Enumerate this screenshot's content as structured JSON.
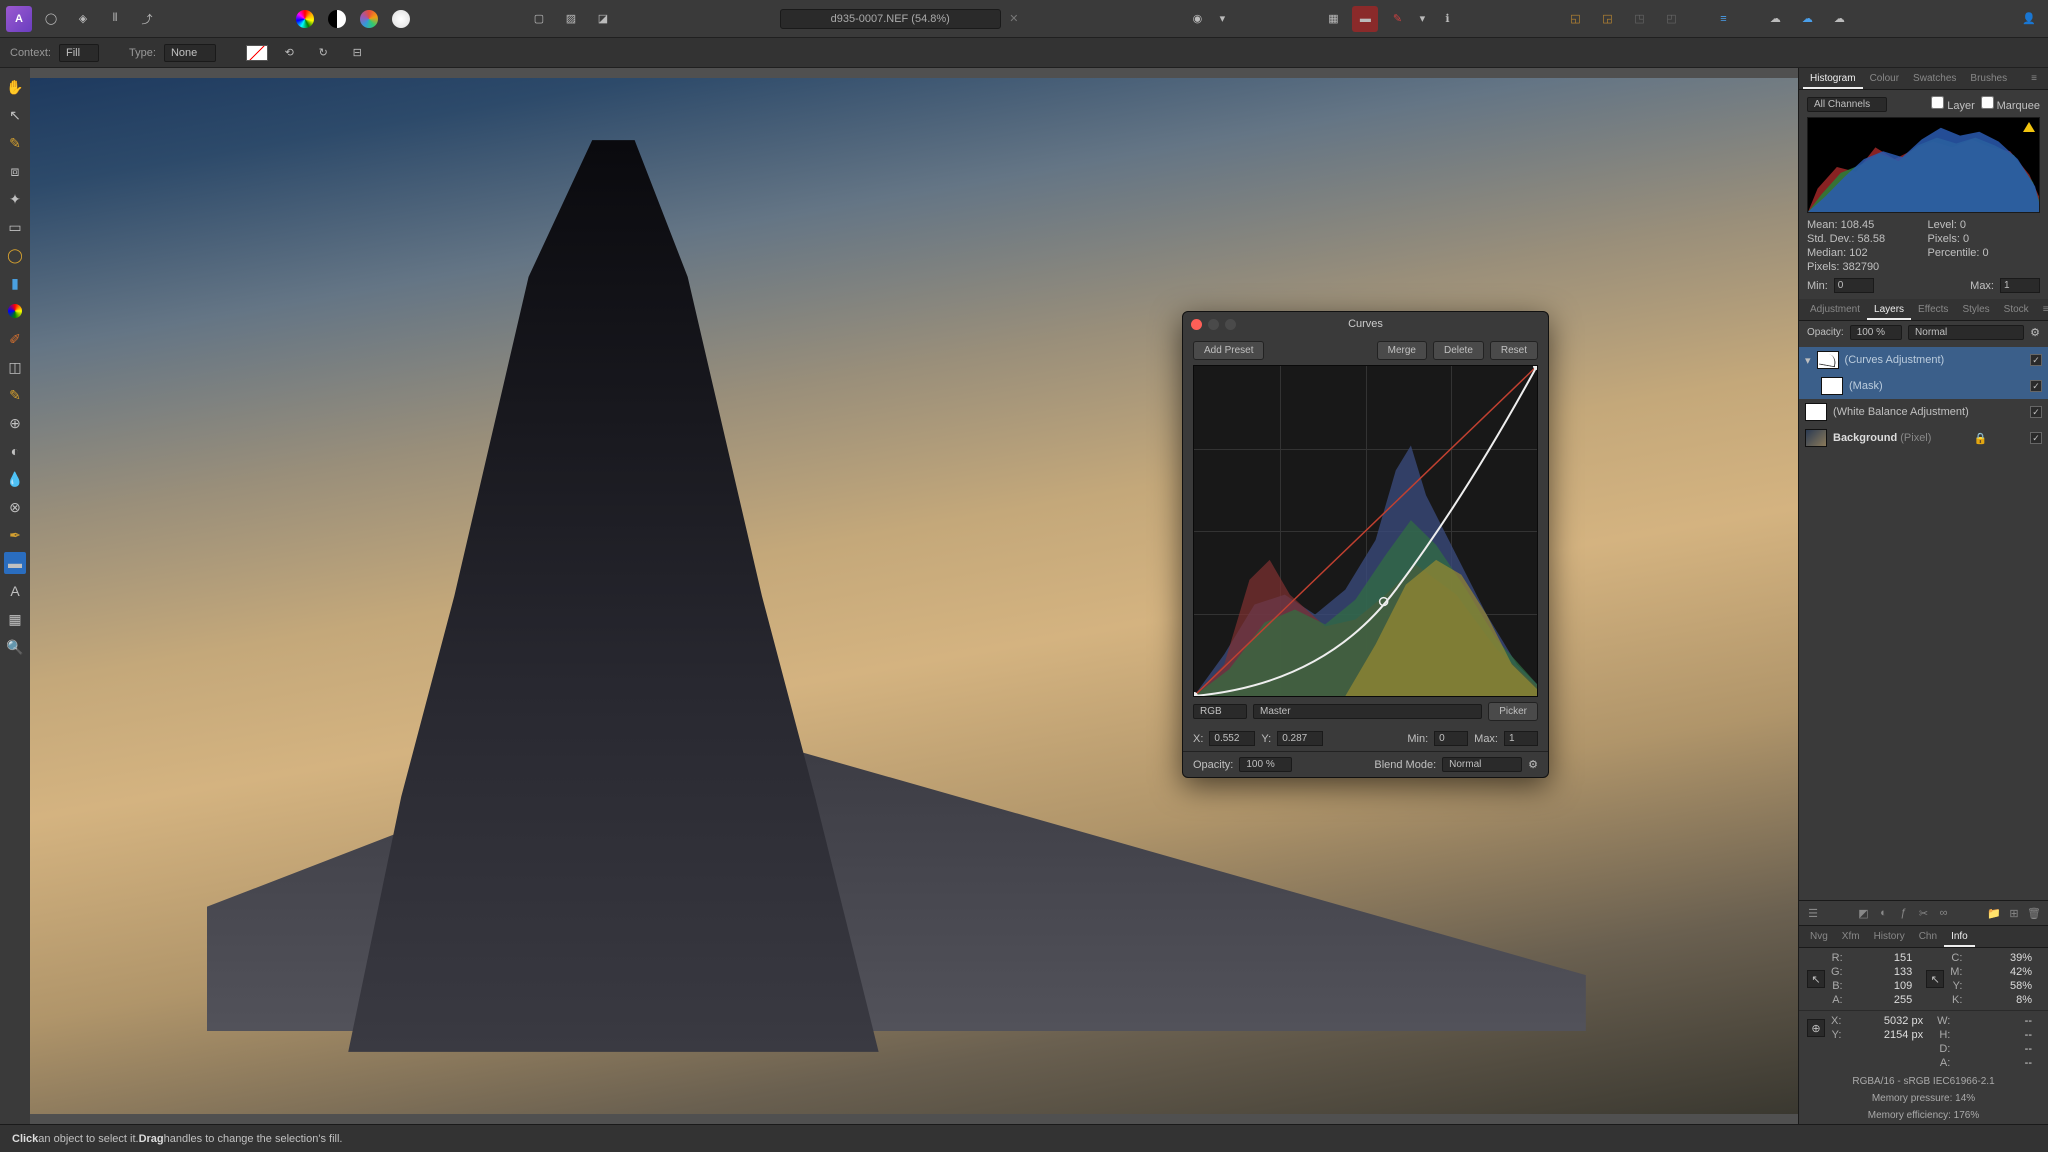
{
  "app": {
    "doc_title": "d935-0007.NEF (54.8%)"
  },
  "context": {
    "label1": "Context:",
    "val1": "Fill",
    "label2": "Type:",
    "val2": "None"
  },
  "status": {
    "click": "Click",
    "click_txt": " an object to select it. ",
    "drag": "Drag",
    "drag_txt": " handles to change the selection's fill."
  },
  "hist_tabs": [
    "Histogram",
    "Colour",
    "Swatches",
    "Brushes"
  ],
  "hist": {
    "channels": "All Channels",
    "layer": "Layer",
    "marquee": "Marquee",
    "mean_k": "Mean:",
    "mean_v": "108.45",
    "sd_k": "Std. Dev.:",
    "sd_v": "58.58",
    "med_k": "Median:",
    "med_v": "102",
    "px_k": "Pixels:",
    "px_v": "382790",
    "lvl_k": "Level:",
    "lvl_v": "0",
    "pxl_k": "Pixels:",
    "pxl_v": "0",
    "pct_k": "Percentile:",
    "pct_v": "0",
    "min_k": "Min:",
    "min_v": "0",
    "max_k": "Max:",
    "max_v": "1"
  },
  "ltabs": [
    "Adjustment",
    "Layers",
    "Effects",
    "Styles",
    "Stock"
  ],
  "layers": {
    "opacity_k": "Opacity:",
    "opacity_v": "100 %",
    "blend": "Normal",
    "l1": "(Curves Adjustment)",
    "l2": "(Mask)",
    "l3": "(White Balance Adjustment)",
    "l4": "Background",
    "l4t": " (Pixel)"
  },
  "btabs": [
    "Nvg",
    "Xfm",
    "History",
    "Chn",
    "Info"
  ],
  "info": {
    "r_k": "R:",
    "r_v": "151",
    "g_k": "G:",
    "g_v": "133",
    "b_k": "B:",
    "b_v": "109",
    "a_k": "A:",
    "a_v": "255",
    "c_k": "C:",
    "c_v": "39%",
    "m_k": "M:",
    "m_v": "42%",
    "y_k": "Y:",
    "y_v": "58%",
    "k_k": "K:",
    "k_v": "8%",
    "x_k": "X:",
    "x_v": "5032 px",
    "yy_k": "Y:",
    "yy_v": "2154 px",
    "w_k": "W:",
    "w_v": "--",
    "h_k": "H:",
    "h_v": "--",
    "d_k": "D:",
    "d_v": "--",
    "a2_k": "A:",
    "a2_v": "--",
    "profile": "RGBA/16 - sRGB IEC61966-2.1",
    "mp": "Memory pressure: 14%",
    "me": "Memory efficiency: 176%"
  },
  "curves": {
    "title": "Curves",
    "add": "Add Preset",
    "merge": "Merge",
    "delete": "Delete",
    "reset": "Reset",
    "space": "RGB",
    "channel": "Master",
    "picker": "Picker",
    "x_k": "X:",
    "x_v": "0.552",
    "y_k": "Y:",
    "y_v": "0.287",
    "min_k": "Min:",
    "min_v": "0",
    "max_k": "Max:",
    "max_v": "1",
    "op_k": "Opacity:",
    "op_v": "100 %",
    "bm_k": "Blend Mode:",
    "bm_v": "Normal"
  }
}
